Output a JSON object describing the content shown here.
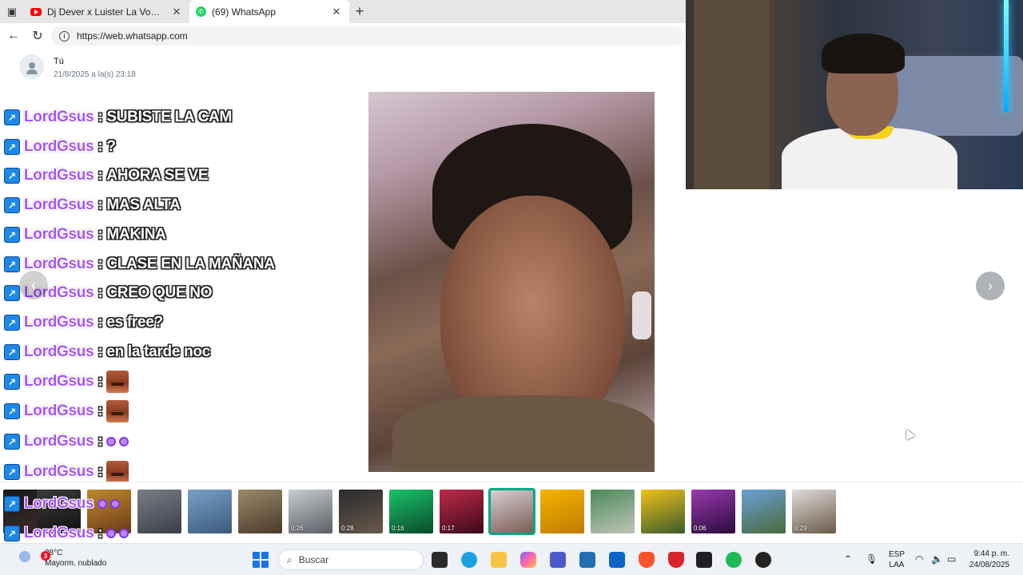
{
  "browser": {
    "tabs": [
      {
        "title": "Dj Dever x Luister La Voz - Quien",
        "icon": "youtube-icon",
        "active": false
      },
      {
        "title": "(69) WhatsApp",
        "icon": "whatsapp-icon",
        "active": true
      }
    ],
    "new_tab_label": "+",
    "url": "https://web.whatsapp.com"
  },
  "viewer": {
    "sender_name": "Tú",
    "sender_date": "21/8/2025 a la(s) 23:18"
  },
  "chat": {
    "lines": [
      {
        "user": "LordGsus",
        "sep": ":",
        "text": "SUBISTE LA CAM"
      },
      {
        "user": "LordGsus",
        "sep": ":",
        "text": "?"
      },
      {
        "user": "LordGsus",
        "sep": ":",
        "text": "AHORA SE VE"
      },
      {
        "user": "LordGsus",
        "sep": ":",
        "text": "MAS ALTA"
      },
      {
        "user": "LordGsus",
        "sep": ":",
        "text": "MAKINA"
      },
      {
        "user": "LordGsus",
        "sep": ":",
        "text": "CLASE EN LA MAÑANA"
      },
      {
        "user": "LordGsus",
        "sep": ":",
        "text": "CREO QUE NO"
      },
      {
        "user": "LordGsus",
        "sep": ":",
        "text": "es free?"
      },
      {
        "user": "LordGsus",
        "sep": ":",
        "text": "en la tarde noc"
      },
      {
        "user": "LordGsus",
        "sep": ":",
        "text": ""
      },
      {
        "user": "LordGsus",
        "sep": ":",
        "text": ""
      },
      {
        "user": "LordGsus",
        "sep": ":",
        "text": ""
      },
      {
        "user": "LordGsus",
        "sep": ":",
        "text": ""
      },
      {
        "user": "LordGsus",
        "sep": "",
        "text": ""
      },
      {
        "user": "LordGsus",
        "sep": ":",
        "text": ""
      }
    ]
  },
  "thumbnails": [
    {
      "duration": "",
      "colors": [
        "#1a1a1a",
        "#3a2a2a"
      ]
    },
    {
      "duration": "",
      "colors": [
        "#3b3b3b",
        "#111"
      ]
    },
    {
      "duration": "",
      "colors": [
        "#c08a2a",
        "#6a3a1a"
      ]
    },
    {
      "duration": "",
      "colors": [
        "#7a7f86",
        "#3a3f46"
      ]
    },
    {
      "duration": "",
      "colors": [
        "#7aa0c8",
        "#3a5a7a"
      ]
    },
    {
      "duration": "",
      "colors": [
        "#9a8a6a",
        "#4a3a2a"
      ]
    },
    {
      "duration": "0:26",
      "colors": [
        "#c9ccd0",
        "#5a5e66"
      ]
    },
    {
      "duration": "0:28",
      "colors": [
        "#2a2a2e",
        "#6a5a4a"
      ]
    },
    {
      "duration": "0:16",
      "colors": [
        "#19c46a",
        "#0a4a2a"
      ]
    },
    {
      "duration": "0:17",
      "colors": [
        "#c02a4a",
        "#3a0a1a"
      ]
    },
    {
      "duration": "",
      "colors": [
        "#d8d0d4",
        "#7a5a52"
      ]
    },
    {
      "duration": "",
      "colors": [
        "#f4b400",
        "#c07a00"
      ]
    },
    {
      "duration": "",
      "colors": [
        "#4a8a5a",
        "#c0c4b8"
      ]
    },
    {
      "duration": "",
      "colors": [
        "#f2c21a",
        "#3a5a2a"
      ]
    },
    {
      "duration": "0:06",
      "colors": [
        "#9a3ab0",
        "#2a0a3a"
      ]
    },
    {
      "duration": "",
      "colors": [
        "#6aa0d8",
        "#4a6a3a"
      ]
    },
    {
      "duration": "0:29",
      "colors": [
        "#e0dcd8",
        "#6a5a4a"
      ]
    }
  ],
  "taskbar": {
    "weather_temp": "28°C",
    "weather_desc": "Mayorm. nublado",
    "weather_badge": "3",
    "search_placeholder": "Buscar",
    "lang_top": "ESP",
    "lang_bottom": "LAA",
    "time": "9:44 p. m.",
    "date": "24/08/2025"
  }
}
